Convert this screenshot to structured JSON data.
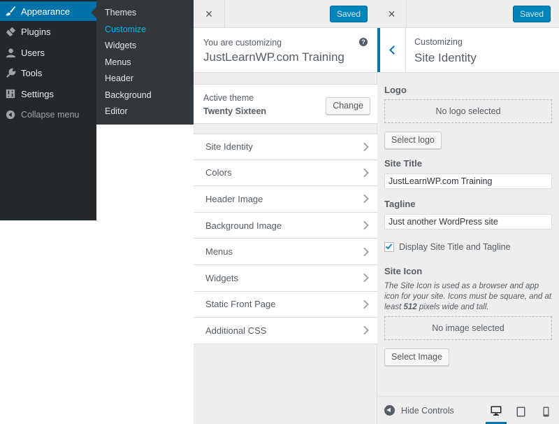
{
  "admin_menu": {
    "items": [
      {
        "label": "Appearance",
        "icon": "paintbrush-icon",
        "current": true
      },
      {
        "label": "Plugins",
        "icon": "plugin-icon"
      },
      {
        "label": "Users",
        "icon": "user-icon"
      },
      {
        "label": "Tools",
        "icon": "wrench-icon"
      },
      {
        "label": "Settings",
        "icon": "settings-icon"
      },
      {
        "label": "Collapse menu",
        "icon": "collapse-icon"
      }
    ],
    "submenu": [
      "Themes",
      "Customize",
      "Widgets",
      "Menus",
      "Header",
      "Background",
      "Editor"
    ],
    "submenu_active": "Customize",
    "accent": "#0073aa",
    "active_link_color": "#00b9eb"
  },
  "customizer": {
    "close_label": "×",
    "saved_label": "Saved",
    "customizing_label": "You are customizing",
    "site_name": "JustLearnWP.com Training",
    "help_icon": "?",
    "active_theme_label": "Active theme",
    "active_theme_name": "Twenty Sixteen",
    "change_label": "Change",
    "sections": [
      "Site Identity",
      "Colors",
      "Header Image",
      "Background Image",
      "Menus",
      "Widgets",
      "Static Front Page",
      "Additional CSS"
    ]
  },
  "site_identity": {
    "close_label": "×",
    "saved_label": "Saved",
    "customizing_label": "Customizing",
    "title": "Site Identity",
    "logo_label": "Logo",
    "no_logo_text": "No logo selected",
    "select_logo_label": "Select logo",
    "site_title_label": "Site Title",
    "site_title_value": "JustLearnWP.com Training",
    "tagline_label": "Tagline",
    "tagline_value": "Just another WordPress site",
    "display_checkbox_label": "Display Site Title and Tagline",
    "display_checked": true,
    "site_icon_label": "Site Icon",
    "site_icon_desc_1": "The Site Icon is used as a browser and app icon for your site. Icons must be square, and at least ",
    "site_icon_desc_num": "512",
    "site_icon_desc_2": " pixels wide and tall.",
    "no_image_text": "No image selected",
    "select_image_label": "Select Image",
    "hide_controls_label": "Hide Controls",
    "devices": [
      "desktop-icon",
      "tablet-icon",
      "mobile-icon"
    ]
  }
}
